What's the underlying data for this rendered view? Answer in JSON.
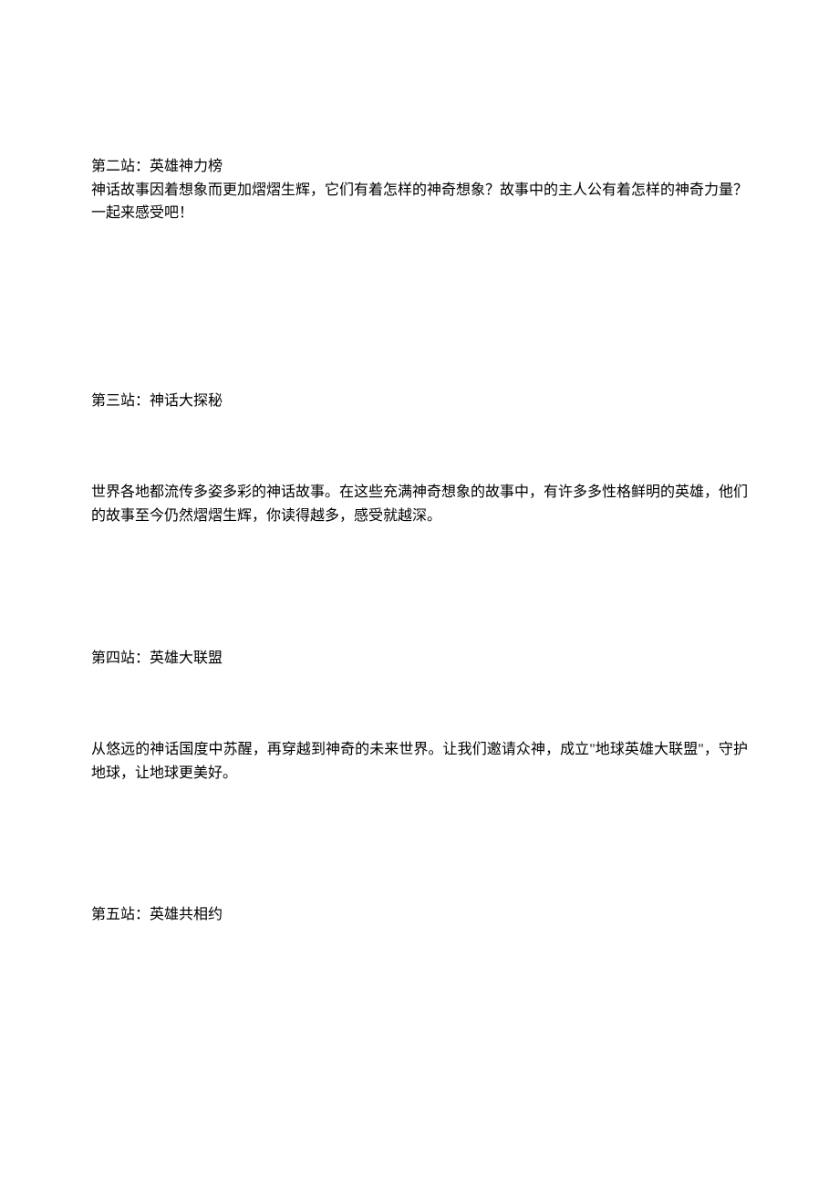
{
  "sections": [
    {
      "title": "第二站：英雄神力榜",
      "body": "神话故事因着想象而更加熠熠生辉，它们有着怎样的神奇想象？故事中的主人公有着怎样的神奇力量？一起来感受吧！"
    },
    {
      "title": "第三站：神话大探秘",
      "body": "世界各地都流传多姿多彩的神话故事。在这些充满神奇想象的故事中，有许多多性格鲜明的英雄，他们的故事至今仍然熠熠生辉，你读得越多，感受就越深。"
    },
    {
      "title": "第四站：英雄大联盟",
      "body": "从悠远的神话国度中苏醒，再穿越到神奇的未来世界。让我们邀请众神，成立\"地球英雄大联盟\"，守护地球，让地球更美好。"
    },
    {
      "title": "第五站：英雄共相约",
      "body": ""
    }
  ]
}
